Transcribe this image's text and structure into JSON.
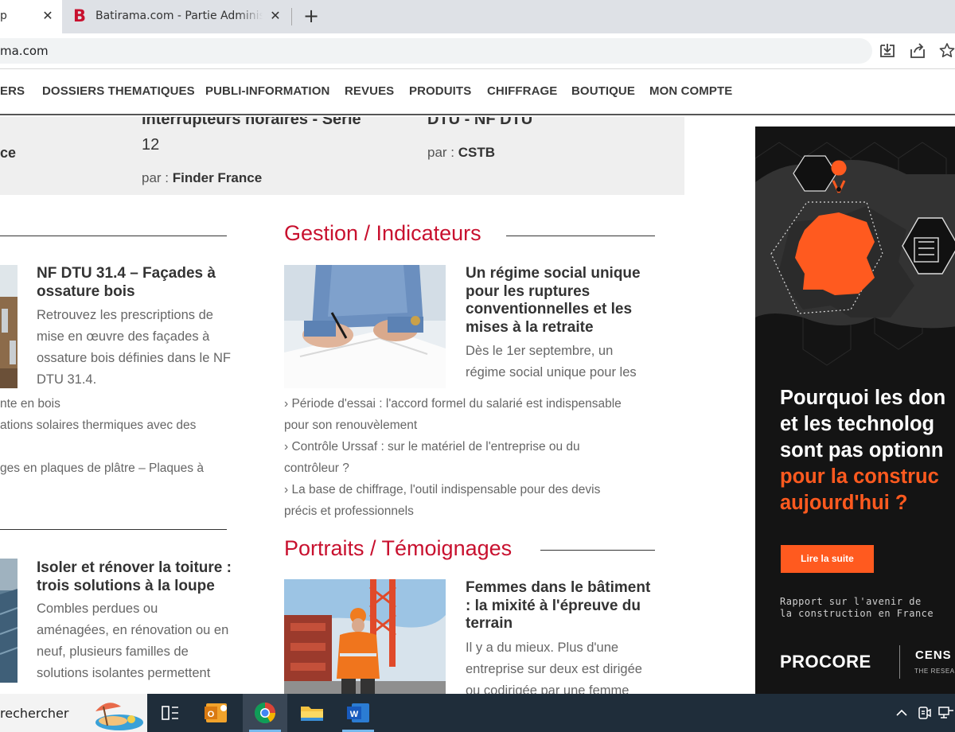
{
  "browser": {
    "active_tab": {
      "title": "p",
      "close_glyph": "✕"
    },
    "tab2": {
      "favicon": "B",
      "title": "Batirama.com - Partie Administrative",
      "close_glyph": "✕"
    },
    "new_tab_glyph": "+",
    "url": "ma.com",
    "icons": [
      "download-icon",
      "share-icon",
      "star-icon"
    ]
  },
  "nav": {
    "items": [
      "ERS",
      "DOSSIERS THEMATIQUES",
      "PUBLI-INFORMATION",
      "REVUES",
      "PRODUITS",
      "CHIFFRAGE",
      "BOUTIQUE",
      "MON COMPTE"
    ]
  },
  "top_strip": {
    "col1": {
      "fragment_1": "ce"
    },
    "col2": {
      "title_cut": "interrupteurs horaires - Série",
      "title_line2": "12",
      "by_label": "par :",
      "by_author": "Finder France"
    },
    "col3": {
      "title_cut": "DTU - NF DTU",
      "by_label": "par :",
      "by_author": "CSTB"
    }
  },
  "left_col": {
    "article1": {
      "title": "NF DTU 31.4 – Façades à ossature bois",
      "body": "Retrouvez les prescriptions de mise en œuvre des façades à ossature bois définies dans le NF DTU 31.4."
    },
    "links": [
      "nte en bois",
      "ations solaires thermiques avec des",
      "ges en plaques de plâtre – Plaques à"
    ],
    "article2": {
      "title": "Isoler et rénover la toiture : trois solutions à la loupe",
      "body": "Combles perdues ou aménagées, en rénovation ou en neuf, plusieurs familles de solutions isolantes permettent"
    }
  },
  "gestion": {
    "section_title": "Gestion / Indicateurs",
    "article": {
      "title": "Un régime social unique pour les ruptures conventionnelles et les mises à la retraite",
      "body": "Dès le 1er septembre, un régime social unique pour les"
    },
    "links": [
      [
        "› Période d'essai : l'accord formel du salarié est indispensable",
        "pour son renouvèlement"
      ],
      [
        "› Contrôle Urssaf : sur le matériel de l'entreprise ou du",
        "contrôleur ?"
      ],
      [
        "› La base de chiffrage, l'outil indispensable pour des devis",
        "précis et professionnels"
      ]
    ]
  },
  "portraits": {
    "section_title": "Portraits / Témoignages",
    "article": {
      "title": "Femmes dans le bâtiment : la mixité à l'épreuve du terrain",
      "body": "Il y a du mieux. Plus d'une entreprise sur deux est dirigée ou codirigée par une femme"
    }
  },
  "ad": {
    "headline_white": [
      "Pourquoi les don",
      "et les technolog",
      "sont pas optionn"
    ],
    "headline_orange": [
      "pour la construc",
      "aujourd'hui ?"
    ],
    "button": "Lire la suite",
    "sub": [
      "Rapport sur l'avenir de",
      "la construction en France"
    ],
    "brand": "PROCORE",
    "partner": "CENS",
    "partner_sub": "THE RESEAR",
    "colors": {
      "accent": "#ff5a1f",
      "background": "#141414"
    }
  },
  "taskbar": {
    "search_text": "rechercher",
    "apps": [
      "task-view-icon",
      "outlook-icon",
      "chrome-icon",
      "file-explorer-icon",
      "word-icon"
    ],
    "tray": [
      "chevron-up-icon",
      "meet-now-icon",
      "network-icon"
    ]
  },
  "colors": {
    "brand_red": "#c8102e",
    "text_dark": "#333333",
    "text_gray": "#666666"
  }
}
